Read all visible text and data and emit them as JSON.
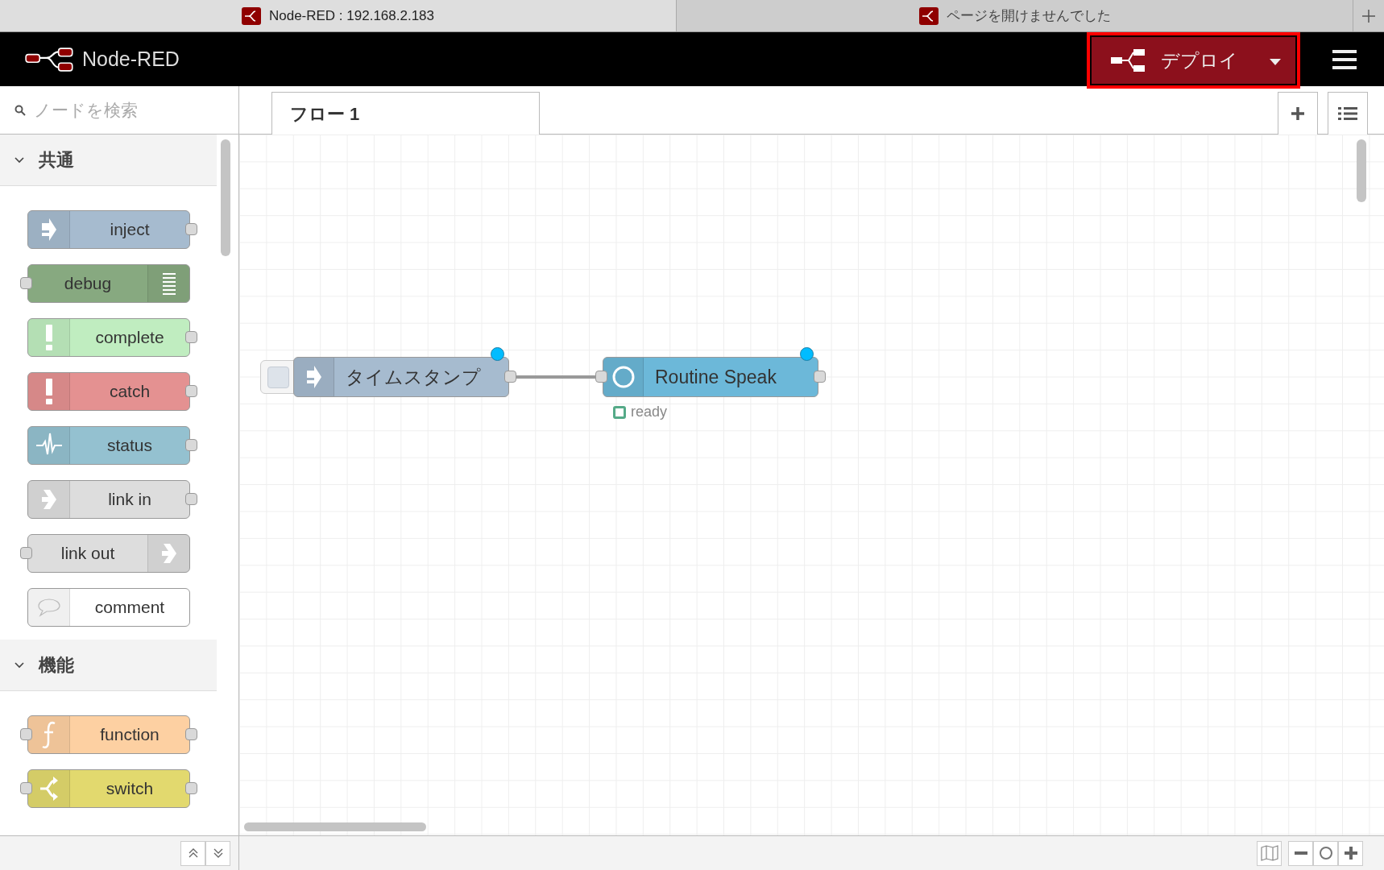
{
  "browser_tabs": [
    {
      "title": "Node-RED : 192.168.2.183",
      "selected": true
    },
    {
      "title": "ページを開けませんでした",
      "selected": false
    }
  ],
  "header": {
    "title": "Node-RED",
    "deploy_label": "デプロイ"
  },
  "palette": {
    "search_placeholder": "ノードを検索",
    "categories": [
      {
        "label": "共通",
        "expanded": true,
        "nodes": [
          {
            "label": "inject",
            "kind": "inject",
            "color": "#a6bbcf",
            "has_input": false,
            "has_output": true,
            "icon_right": false
          },
          {
            "label": "debug",
            "kind": "debug",
            "color": "#87a980",
            "has_input": true,
            "has_output": false,
            "icon_right": true
          },
          {
            "label": "complete",
            "kind": "alert",
            "color": "#c0edc0",
            "has_input": false,
            "has_output": true,
            "icon_right": false
          },
          {
            "label": "catch",
            "kind": "alert",
            "color": "#e49191",
            "has_input": false,
            "has_output": true,
            "icon_right": false
          },
          {
            "label": "status",
            "kind": "pulse",
            "color": "#94c1d0",
            "has_input": false,
            "has_output": true,
            "icon_right": false
          },
          {
            "label": "link in",
            "kind": "link",
            "color": "#dddddd",
            "has_input": false,
            "has_output": true,
            "icon_right": false
          },
          {
            "label": "link out",
            "kind": "link",
            "color": "#dddddd",
            "has_input": true,
            "has_output": false,
            "icon_right": true
          },
          {
            "label": "comment",
            "kind": "comment",
            "color": "#ffffff",
            "has_input": false,
            "has_output": false,
            "icon_right": false
          }
        ]
      },
      {
        "label": "機能",
        "expanded": true,
        "nodes": [
          {
            "label": "function",
            "kind": "function",
            "color": "#fdd0a2",
            "has_input": true,
            "has_output": true,
            "icon_right": false
          },
          {
            "label": "switch",
            "kind": "switch",
            "color": "#e2d96e",
            "has_input": true,
            "has_output": true,
            "icon_right": false
          }
        ]
      }
    ]
  },
  "workspace_tabs": [
    {
      "label": "フロー 1",
      "selected": true
    }
  ],
  "flow_nodes": [
    {
      "label": "タイムスタンプ",
      "kind": "inject",
      "color": "#a6bbcf",
      "has_input": false,
      "has_output": true,
      "changed": true,
      "has_button": true,
      "wired_to_next": true
    },
    {
      "label": "Routine Speak",
      "kind": "ring",
      "color": "#6cb8d9",
      "has_input": true,
      "has_output": true,
      "changed": true,
      "has_button": false,
      "status": {
        "text": "ready",
        "color": "#55aa88"
      }
    }
  ]
}
